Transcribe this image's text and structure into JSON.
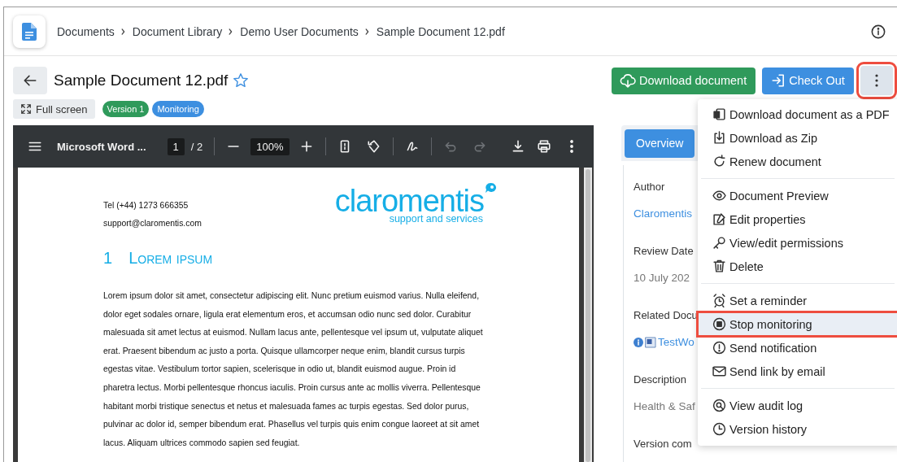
{
  "header": {
    "breadcrumb": [
      "Documents",
      "Document Library",
      "Demo User Documents",
      "Sample Document 12.pdf"
    ]
  },
  "document": {
    "title": "Sample Document 12.pdf",
    "starred": false
  },
  "actions": [
    {
      "label": "Download document",
      "kind": "download"
    },
    {
      "label": "Check Out",
      "kind": "checkout"
    }
  ],
  "more_button": {
    "highlighted": true
  },
  "full_screen": "Full screen",
  "badges": [
    {
      "label": "Version 1",
      "color": "#2f9a5b"
    },
    {
      "label": "Monitoring",
      "color": "#3d8fe0"
    }
  ],
  "viewer": {
    "filename": "Microsoft Word ...",
    "page": "1",
    "page_total": "/ 2",
    "zoom": "100%",
    "page_content": {
      "phone": "Tel (+44) 1273 666355",
      "email": "support@claromentis.com",
      "logo_name": "claromentis",
      "logo_tagline": "support and services",
      "heading_number": "1",
      "heading": "Lorem ipsum",
      "paragraph": "Lorem ipsum dolor sit amet, consectetur adipiscing elit. Nunc pretium euismod varius. Nulla eleifend, dolor eget sodales ornare, ligula erat elementum eros, et accumsan odio nunc sed dolor. Curabitur malesuada sit amet lectus at euismod. Nullam lacus ante, pellentesque vel ipsum ut, vulputate aliquet erat. Praesent bibendum ac justo a porta. Quisque ullamcorper neque enim, blandit cursus turpis egestas vitae. Vestibulum tortor sapien, scelerisque in odio ut, blandit euismod augue. Proin id pharetra lectus. Morbi pellentesque rhoncus iaculis. Proin cursus ante ac mollis viverra. Pellentesque habitant morbi tristique senectus et netus et malesuada fames ac turpis egestas. Sed dolor purus, pulvinar ac dolor id, semper bibendum erat. Phasellus vel turpis quis enim congue laoreet at sit amet lacus. Aliquam ultrices commodo sapien sed feugiat."
    }
  },
  "details": {
    "tabs": [
      {
        "label": "Overview",
        "selected": true
      }
    ],
    "fields": [
      {
        "label": "Author",
        "value": "Claromentis",
        "kind": "link"
      },
      {
        "label": "Review Date",
        "value": "10 July 202",
        "kind": "text"
      },
      {
        "label": "Related Docu",
        "value": "TestWo",
        "kind": "file"
      },
      {
        "label": "Description",
        "value": "Health & Saf",
        "kind": "text"
      },
      {
        "label": "Version com"
      }
    ]
  },
  "menu": {
    "groups": [
      [
        {
          "label": "Download document as a PDF",
          "highlighted": false
        },
        {
          "label": "Download as Zip",
          "highlighted": false
        },
        {
          "label": "Renew document",
          "highlighted": false
        }
      ],
      [
        {
          "label": "Document Preview",
          "highlighted": false
        },
        {
          "label": "Edit properties",
          "highlighted": false
        },
        {
          "label": "View/edit permissions",
          "highlighted": false
        },
        {
          "label": "Delete",
          "highlighted": false
        }
      ],
      [
        {
          "label": "Set a reminder",
          "highlighted": false
        },
        {
          "label": "Stop monitoring",
          "highlighted": true
        },
        {
          "label": "Send notification",
          "highlighted": false
        },
        {
          "label": "Send link by email",
          "highlighted": false
        }
      ],
      [
        {
          "label": "View audit log",
          "highlighted": false
        },
        {
          "label": "Version history",
          "highlighted": false
        }
      ]
    ]
  }
}
